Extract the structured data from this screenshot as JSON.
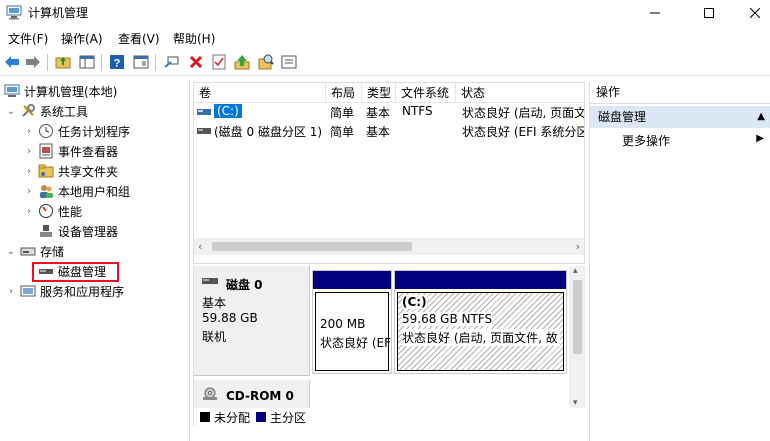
{
  "window": {
    "title": "计算机管理"
  },
  "menu": [
    "文件(F)",
    "操作(A)",
    "查看(V)",
    "帮助(H)"
  ],
  "toolbar": {
    "icons": [
      "back-arrow-icon",
      "forward-arrow-icon",
      "up-folder-icon",
      "show-hide-tree-icon",
      "help-icon",
      "properties-icon",
      "connect-icon",
      "delete-icon",
      "check-icon",
      "upload-icon",
      "search-icon",
      "console-icon"
    ]
  },
  "tree": {
    "root": "计算机管理(本地)",
    "items": [
      {
        "label": "系统工具"
      },
      {
        "label": "任务计划程序"
      },
      {
        "label": "事件查看器"
      },
      {
        "label": "共享文件夹"
      },
      {
        "label": "本地用户和组"
      },
      {
        "label": "性能"
      },
      {
        "label": "设备管理器"
      },
      {
        "label": "存储"
      },
      {
        "label": "磁盘管理"
      },
      {
        "label": "服务和应用程序"
      }
    ]
  },
  "volumes": {
    "columns": [
      "卷",
      "布局",
      "类型",
      "文件系统",
      "状态"
    ],
    "rows": [
      {
        "volume": "(C:)",
        "layout": "简单",
        "type": "基本",
        "fs": "NTFS",
        "status": "状态良好 (启动, 页面文"
      },
      {
        "volume": "(磁盘 0 磁盘分区 1)",
        "layout": "简单",
        "type": "基本",
        "fs": "",
        "status": "状态良好 (EFI 系统分区"
      }
    ]
  },
  "disks": {
    "disk0": {
      "name": "磁盘 0",
      "type": "基本",
      "size": "59.88 GB",
      "state": "联机",
      "partitions": [
        {
          "size": "200 MB",
          "status": "状态良好 (EFI"
        },
        {
          "label": "(C:)",
          "size": "59.68 GB NTFS",
          "status": "状态良好 (启动, 页面文件, 故"
        }
      ]
    },
    "cdrom": {
      "name": "CD-ROM 0"
    }
  },
  "legend": [
    {
      "label": "未分配",
      "color": "#000000"
    },
    {
      "label": "主分区",
      "color": "#000080"
    }
  ],
  "actions": {
    "header": "操作",
    "section": "磁盘管理",
    "item": "更多操作"
  },
  "colors": {
    "highlight": "#e81123",
    "partition_bar": "#000080",
    "selected_bg": "#dbe7f5"
  }
}
